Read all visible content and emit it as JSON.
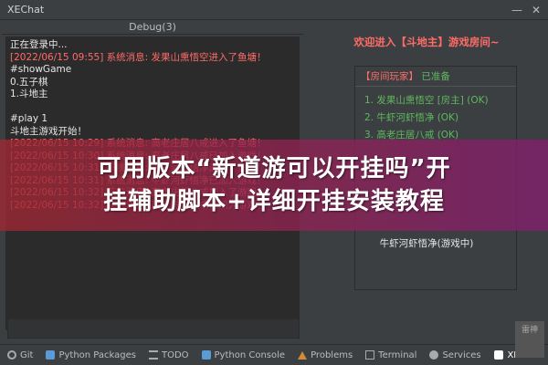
{
  "window": {
    "title": "XEChat",
    "minimize": "—",
    "close": "✕"
  },
  "debug": {
    "header": "Debug(3)",
    "lines": [
      {
        "text": "正在登录中...",
        "type": "normal"
      },
      {
        "text": "[2022/06/15 09:55] 系统消息: 发果山熏悟空进入了鱼塘！",
        "type": "sys"
      },
      {
        "text": "#showGame",
        "type": "normal"
      },
      {
        "text": "0.五子棋",
        "type": "normal"
      },
      {
        "text": "1.斗地主",
        "type": "normal"
      },
      {
        "text": "",
        "type": "gap"
      },
      {
        "text": "#play 1",
        "type": "normal"
      },
      {
        "text": "斗地主游戏开始！",
        "type": "normal"
      },
      {
        "text": "[2022/06/15 10:29] 系统消息: 高老庄居八戒进入了鱼塘！",
        "type": "sys"
      },
      {
        "text": "[2022/06/15 10:30] 系统消息: 高老庄居八戒已加入游戏！",
        "type": "sys"
      },
      {
        "text": "[2022/06/15 10:31] 系统消息: 牛虾河虾悟净进入了鱼塘！",
        "type": "sys"
      },
      {
        "text": "[2022/06/15 10:31] 系统消息: 牛虾河虾悟净已加入游戏！",
        "type": "sys"
      },
      {
        "text": "[2022/06/15 10:32] 系统消息: 高老庄居八戒加入了游戏！",
        "type": "sys"
      },
      {
        "text": "[2022/06/15 10:32] 系统消息: 高老庄居八戒已加入游戏！",
        "type": "sys"
      }
    ]
  },
  "room": {
    "welcome": "欢迎进入【斗地主】游戏房间~",
    "title": "【房间玩家】",
    "ready": "已准备",
    "players": [
      "1. 发果山熏悟空 [房主] (OK)",
      "2. 牛虾河虾悟净 (OK)",
      "3. 高老庄居八戒 (OK)"
    ],
    "bottom_text": "牛虾河虾悟净(游戏中)"
  },
  "overlay": {
    "line1": "可用版本“新道游可以开挂吗”开",
    "line2": "挂辅助脚本+详细开挂安装教程"
  },
  "statusbar": {
    "items": [
      {
        "label": "Git",
        "icon": "git-icon"
      },
      {
        "label": "Python Packages",
        "icon": "python-packages-icon"
      },
      {
        "label": "TODO",
        "icon": "todo-icon"
      },
      {
        "label": "Python Console",
        "icon": "python-console-icon"
      },
      {
        "label": "Problems",
        "icon": "problems-icon"
      },
      {
        "label": "Terminal",
        "icon": "terminal-icon"
      },
      {
        "label": "Services",
        "icon": "services-icon"
      }
    ],
    "active": "XEChat"
  },
  "watermark": "雷神"
}
